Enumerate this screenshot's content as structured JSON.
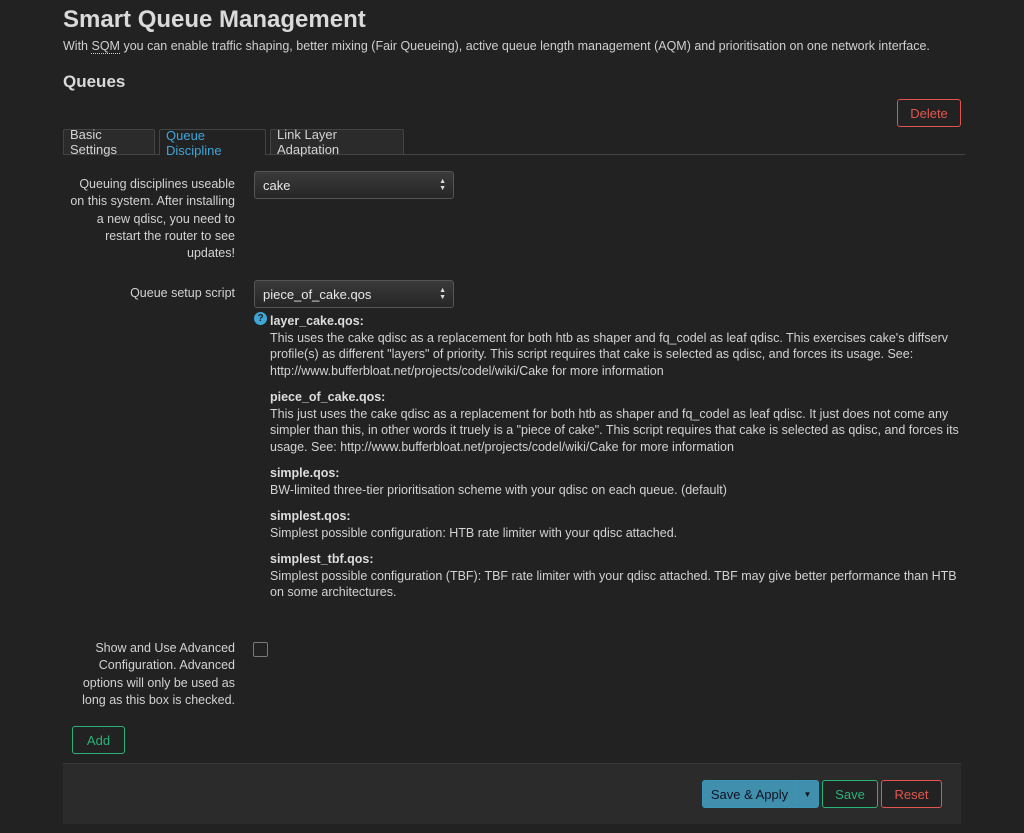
{
  "page": {
    "title": "Smart Queue Management",
    "description_prefix": "With ",
    "description_abbr": "SQM",
    "description_suffix": " you can enable traffic shaping, better mixing (Fair Queueing), active queue length management (AQM) and prioritisation on one network interface."
  },
  "section": {
    "title": "Queues",
    "delete_label": "Delete"
  },
  "tabs": [
    {
      "label": "Basic Settings",
      "active": false
    },
    {
      "label": "Queue Discipline",
      "active": true
    },
    {
      "label": "Link Layer Adaptation",
      "active": false
    }
  ],
  "qdisc": {
    "label": "Queuing disciplines useable on this system. After installing a new qdisc, you need to restart the router to see updates!",
    "value": "cake"
  },
  "script": {
    "label": "Queue setup script",
    "value": "piece_of_cake.qos",
    "help_icon": "question-circle-icon",
    "descriptions": [
      {
        "name": "layer_cake.qos:",
        "text": "This uses the cake qdisc as a replacement for both htb as shaper and fq_codel as leaf qdisc. This exercises cake's diffserv profile(s) as different \"layers\" of priority. This script requires that cake is selected as qdisc, and forces its usage. See: http://www.bufferbloat.net/projects/codel/wiki/Cake for more information"
      },
      {
        "name": "piece_of_cake.qos:",
        "text": "This just uses the cake qdisc as a replacement for both htb as shaper and fq_codel as leaf qdisc. It just does not come any simpler than this, in other words it truely is a \"piece of cake\". This script requires that cake is selected as qdisc, and forces its usage. See: http://www.bufferbloat.net/projects/codel/wiki/Cake for more information"
      },
      {
        "name": "simple.qos:",
        "text": "BW-limited three-tier prioritisation scheme with your qdisc on each queue. (default)"
      },
      {
        "name": "simplest.qos:",
        "text": "Simplest possible configuration: HTB rate limiter with your qdisc attached."
      },
      {
        "name": "simplest_tbf.qos:",
        "text": "Simplest possible configuration (TBF): TBF rate limiter with your qdisc attached. TBF may give better performance than HTB on some architectures."
      }
    ]
  },
  "advanced": {
    "label": "Show and Use Advanced Configuration. Advanced options will only be used as long as this box is checked.",
    "checked": false
  },
  "buttons": {
    "add": "Add",
    "save_apply": "Save & Apply",
    "save": "Save",
    "reset": "Reset"
  },
  "colors": {
    "background": "#222222",
    "accent": "#3ea5d7",
    "positive": "#2ab27b",
    "negative": "#e0564f"
  }
}
